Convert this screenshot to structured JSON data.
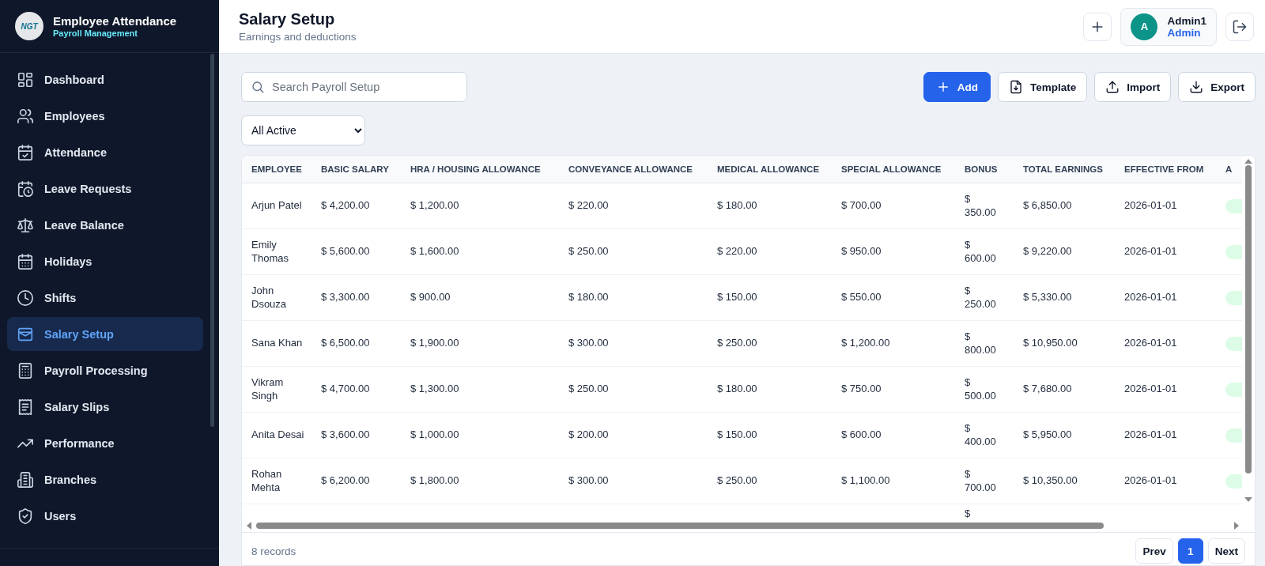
{
  "sidebar": {
    "brand": {
      "logo_text": "NGT",
      "title": "Employee Attendance",
      "subtitle": "Payroll Management"
    },
    "items": [
      {
        "label": "Dashboard",
        "selected": false
      },
      {
        "label": "Employees",
        "selected": false
      },
      {
        "label": "Attendance",
        "selected": false
      },
      {
        "label": "Leave Requests",
        "selected": false
      },
      {
        "label": "Leave Balance",
        "selected": false
      },
      {
        "label": "Holidays",
        "selected": false
      },
      {
        "label": "Shifts",
        "selected": false
      },
      {
        "label": "Salary Setup",
        "selected": true
      },
      {
        "label": "Payroll Processing",
        "selected": false
      },
      {
        "label": "Salary Slips",
        "selected": false
      },
      {
        "label": "Performance",
        "selected": false
      },
      {
        "label": "Branches",
        "selected": false
      },
      {
        "label": "Users",
        "selected": false
      }
    ]
  },
  "header": {
    "title": "Salary Setup",
    "subtitle": "Earnings and deductions",
    "user": {
      "initial": "A",
      "name": "Admin1",
      "role": "Admin"
    }
  },
  "toolbar": {
    "search": {
      "placeholder": "Search Payroll Setup"
    },
    "filter": {
      "value": "All Active"
    },
    "buttons": [
      {
        "label": "Add",
        "kind": "primary"
      },
      {
        "label": "Template",
        "kind": "secondary"
      },
      {
        "label": "Import",
        "kind": "secondary"
      },
      {
        "label": "Export",
        "kind": "secondary"
      }
    ]
  },
  "table": {
    "columns": [
      "EMPLOYEE",
      "BASIC SALARY",
      "HRA / HOUSING ALLOWANCE",
      "CONVEYANCE ALLOWANCE",
      "MEDICAL ALLOWANCE",
      "SPECIAL ALLOWANCE",
      "BONUS",
      "TOTAL EARNINGS",
      "EFFECTIVE FROM",
      "A"
    ],
    "rows": [
      {
        "cells": [
          "Arjun Patel",
          "$ 4,200.00",
          "$ 1,200.00",
          "$ 220.00",
          "$ 180.00",
          "$ 700.00",
          "$ 350.00",
          "$ 6,850.00",
          "2026-01-01"
        ]
      },
      {
        "cells": [
          "Emily Thomas",
          "$ 5,600.00",
          "$ 1,600.00",
          "$ 250.00",
          "$ 220.00",
          "$ 950.00",
          "$ 600.00",
          "$ 9,220.00",
          "2026-01-01"
        ]
      },
      {
        "cells": [
          "John Dsouza",
          "$ 3,300.00",
          "$ 900.00",
          "$ 180.00",
          "$ 150.00",
          "$ 550.00",
          "$ 250.00",
          "$ 5,330.00",
          "2026-01-01"
        ]
      },
      {
        "cells": [
          "Sana Khan",
          "$ 6,500.00",
          "$ 1,900.00",
          "$ 300.00",
          "$ 250.00",
          "$ 1,200.00",
          "$ 800.00",
          "$ 10,950.00",
          "2026-01-01"
        ]
      },
      {
        "cells": [
          "Vikram Singh",
          "$ 4,700.00",
          "$ 1,300.00",
          "$ 250.00",
          "$ 180.00",
          "$ 750.00",
          "$ 500.00",
          "$ 7,680.00",
          "2026-01-01"
        ]
      },
      {
        "cells": [
          "Anita Desai",
          "$ 3,600.00",
          "$ 1,000.00",
          "$ 200.00",
          "$ 150.00",
          "$ 600.00",
          "$ 400.00",
          "$ 5,950.00",
          "2026-01-01"
        ]
      },
      {
        "cells": [
          "Rohan Mehta",
          "$ 6,200.00",
          "$ 1,800.00",
          "$ 300.00",
          "$ 250.00",
          "$ 1,100.00",
          "$ 700.00",
          "$ 10,350.00",
          "2026-01-01"
        ]
      }
    ],
    "partial_row": {
      "bonus": "$"
    },
    "footer": {
      "count": "8 records",
      "pages": [
        {
          "label": "1",
          "selected": true
        }
      ],
      "prev": "Prev",
      "next": "Next"
    }
  }
}
